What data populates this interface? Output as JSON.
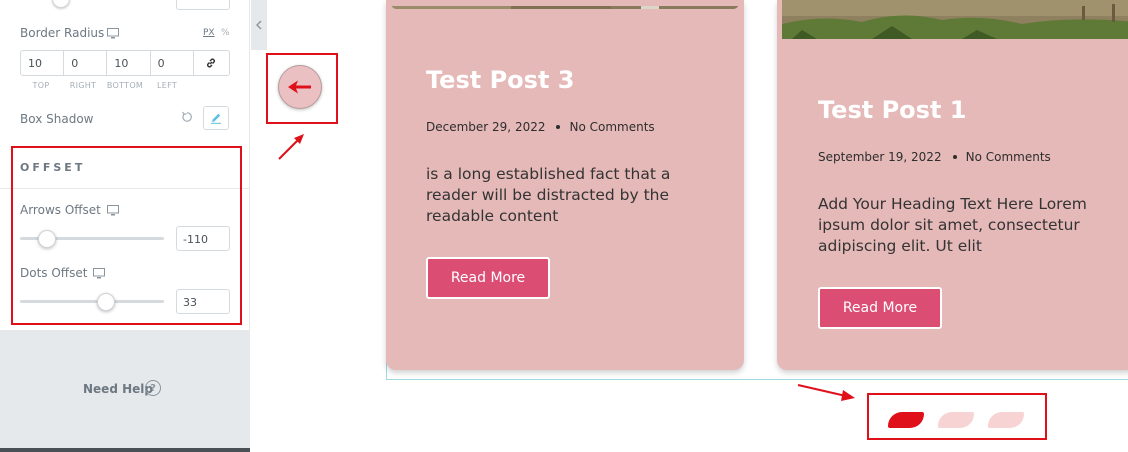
{
  "panel": {
    "border_radius": {
      "label": "Border Radius",
      "unit_px": "PX",
      "unit_percent": "%",
      "values": [
        "10",
        "0",
        "10",
        "0"
      ],
      "labels": [
        "TOP",
        "RIGHT",
        "BOTTOM",
        "LEFT"
      ]
    },
    "box_shadow_label": "Box Shadow",
    "offset": {
      "title": "OFFSET",
      "arrows_label": "Arrows Offset",
      "arrows_value": "-110",
      "arrows_slider_fraction": 0.19,
      "dots_label": "Dots Offset",
      "dots_value": "33",
      "dots_slider_fraction": 0.6
    },
    "help_text": "Need Help"
  },
  "preview": {
    "posts": [
      {
        "title": "Test Post 3",
        "date": "December 29, 2022",
        "comments": "No Comments",
        "excerpt": " is a long established fact that a reader will be distracted by the readable content",
        "button": "Read More"
      },
      {
        "title": "Test Post 1",
        "date": "September 19, 2022",
        "comments": "No Comments",
        "excerpt": "Add Your Heading Text Here Lorem ipsum dolor sit amet, consectetur adipiscing elit. Ut elit",
        "button": "Read More"
      }
    ],
    "dots_active_index": 0
  },
  "colors": {
    "card_bg": "#e6b9b9",
    "button_bg": "#dc4d74",
    "dot_active": "#e0101a",
    "dot_inactive": "#f7d3d3",
    "annotation": "#e0101a"
  },
  "icons": [
    "monitor-icon",
    "link-icon",
    "reset-icon",
    "pencil-icon",
    "help-icon",
    "chevron-left-icon",
    "arrow-left-icon",
    "annotation-arrow-icon"
  ]
}
